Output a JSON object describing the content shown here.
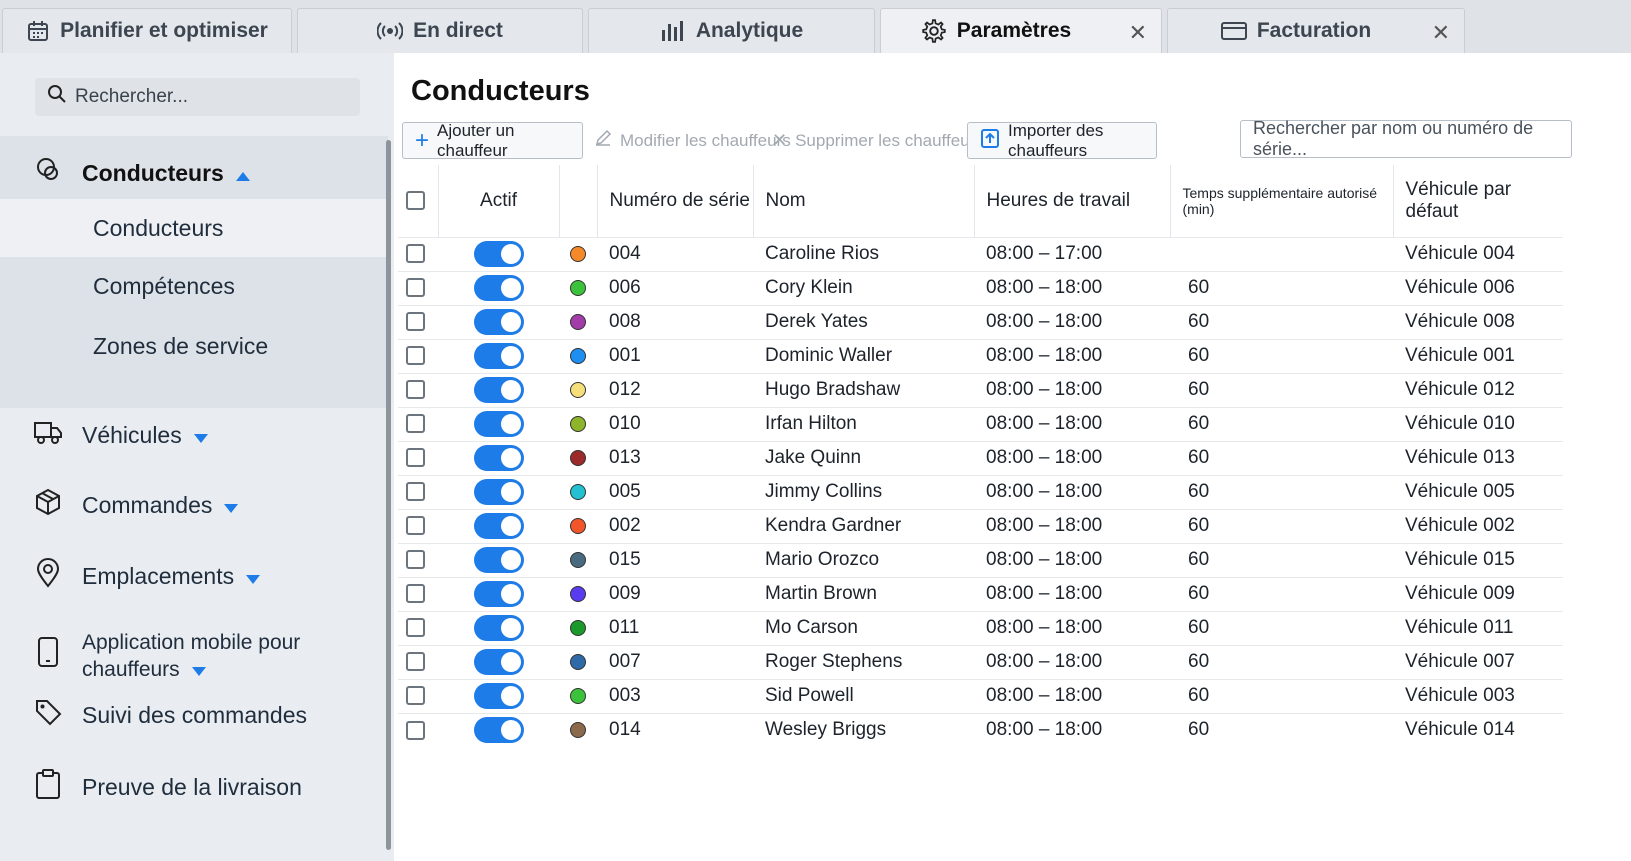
{
  "tabs": [
    {
      "label": "Planifier et optimiser",
      "icon": "calendar-icon"
    },
    {
      "label": "En direct",
      "icon": "broadcast-icon"
    },
    {
      "label": "Analytique",
      "icon": "bar-chart-icon"
    },
    {
      "label": "Paramètres",
      "icon": "gear-icon",
      "active": true,
      "close": "✕"
    },
    {
      "label": "Facturation",
      "icon": "credit-card-icon",
      "close": "✕"
    }
  ],
  "sidebar": {
    "search_placeholder": "Rechercher...",
    "group_label": "Conducteurs",
    "sub_items": [
      "Conducteurs",
      "Compétences",
      "Zones de service"
    ],
    "items": [
      {
        "label": "Véhicules",
        "icon": "truck-icon"
      },
      {
        "label": "Commandes",
        "icon": "box-icon"
      },
      {
        "label": "Emplacements",
        "icon": "map-pin-icon"
      },
      {
        "label": "Application mobile pour chauffeurs",
        "icon": "phone-icon"
      },
      {
        "label": "Suivi des commandes",
        "icon": "tag-icon"
      },
      {
        "label": "Preuve de la livraison",
        "icon": "clipboard-icon"
      }
    ]
  },
  "main": {
    "title": "Conducteurs",
    "toolbar": {
      "add": "Ajouter un chauffeur",
      "edit": "Modifier les chauffeurs",
      "delete": "Supprimer les chauffeurs",
      "import": "Importer des chauffeurs",
      "search_placeholder": "Rechercher par nom ou numéro de série..."
    },
    "columns": [
      "Actif",
      "Numéro de série",
      "Nom",
      "Heures de travail",
      "Temps supplémentaire autorisé (min)",
      "Véhicule par défaut"
    ],
    "rows": [
      {
        "color": "#f5892a",
        "serial": "004",
        "name": "Caroline Rios",
        "hours": "08:00 – 17:00",
        "overtime": "",
        "vehicle": "Véhicule 004"
      },
      {
        "color": "#3cc23a",
        "serial": "006",
        "name": "Cory Klein",
        "hours": "08:00 – 18:00",
        "overtime": "60",
        "vehicle": "Véhicule 006"
      },
      {
        "color": "#a23ca8",
        "serial": "008",
        "name": "Derek Yates",
        "hours": "08:00 – 18:00",
        "overtime": "60",
        "vehicle": "Véhicule 008"
      },
      {
        "color": "#1e8ef0",
        "serial": "001",
        "name": "Dominic Waller",
        "hours": "08:00 – 18:00",
        "overtime": "60",
        "vehicle": "Véhicule 001"
      },
      {
        "color": "#f5df7a",
        "serial": "012",
        "name": "Hugo Bradshaw",
        "hours": "08:00 – 18:00",
        "overtime": "60",
        "vehicle": "Véhicule 012"
      },
      {
        "color": "#8cb52a",
        "serial": "010",
        "name": "Irfan Hilton",
        "hours": "08:00 – 18:00",
        "overtime": "60",
        "vehicle": "Véhicule 010"
      },
      {
        "color": "#9c2a2a",
        "serial": "013",
        "name": "Jake Quinn",
        "hours": "08:00 – 18:00",
        "overtime": "60",
        "vehicle": "Véhicule 013"
      },
      {
        "color": "#22c0d0",
        "serial": "005",
        "name": "Jimmy Collins",
        "hours": "08:00 – 18:00",
        "overtime": "60",
        "vehicle": "Véhicule 005"
      },
      {
        "color": "#f2552a",
        "serial": "002",
        "name": "Kendra Gardner",
        "hours": "08:00 – 18:00",
        "overtime": "60",
        "vehicle": "Véhicule 002"
      },
      {
        "color": "#4a6a80",
        "serial": "015",
        "name": "Mario Orozco",
        "hours": "08:00 – 18:00",
        "overtime": "60",
        "vehicle": "Véhicule 015"
      },
      {
        "color": "#5a3cf0",
        "serial": "009",
        "name": "Martin Brown",
        "hours": "08:00 – 18:00",
        "overtime": "60",
        "vehicle": "Véhicule 009"
      },
      {
        "color": "#1a9a2a",
        "serial": "011",
        "name": "Mo Carson",
        "hours": "08:00 – 18:00",
        "overtime": "60",
        "vehicle": "Véhicule 011"
      },
      {
        "color": "#2f6aa8",
        "serial": "007",
        "name": "Roger Stephens",
        "hours": "08:00 – 18:00",
        "overtime": "60",
        "vehicle": "Véhicule 007"
      },
      {
        "color": "#3cc23a",
        "serial": "003",
        "name": "Sid Powell",
        "hours": "08:00 – 18:00",
        "overtime": "60",
        "vehicle": "Véhicule 003"
      },
      {
        "color": "#8a6a4a",
        "serial": "014",
        "name": "Wesley Briggs",
        "hours": "08:00 – 18:00",
        "overtime": "60",
        "vehicle": "Véhicule 014"
      }
    ]
  },
  "colors": {
    "accent": "#1e7ce8"
  }
}
